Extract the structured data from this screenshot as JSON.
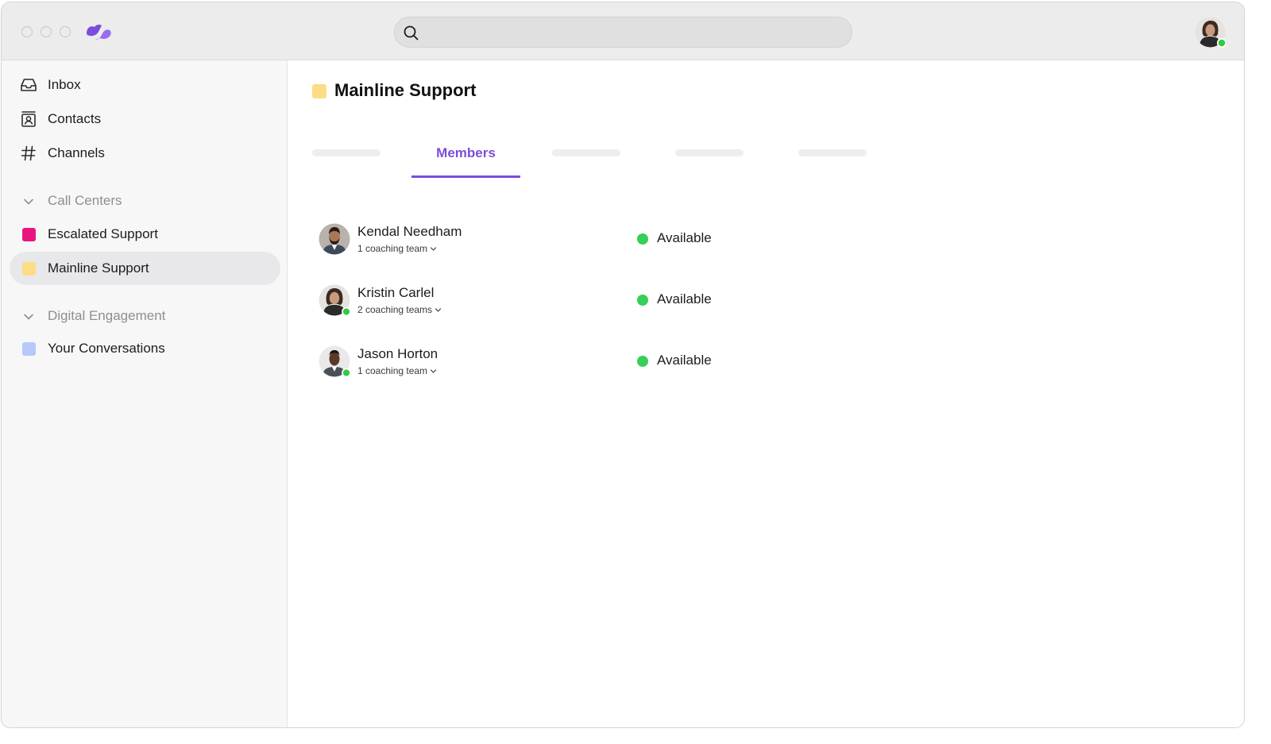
{
  "colors": {
    "accent": "#7c4ddb",
    "online": "#2ecc40",
    "available": "#34d058",
    "escalated_support": "#e8157f",
    "mainline_support": "#fcdc85",
    "your_conversations": "#b6c8fa"
  },
  "search": {
    "placeholder": ""
  },
  "sidebar": {
    "nav": [
      {
        "label": "Inbox",
        "icon": "inbox-icon"
      },
      {
        "label": "Contacts",
        "icon": "contacts-icon"
      },
      {
        "label": "Channels",
        "icon": "hash-icon"
      }
    ],
    "sections": [
      {
        "title": "Call Centers",
        "items": [
          {
            "label": "Escalated Support",
            "color": "#e8157f"
          },
          {
            "label": "Mainline Support",
            "color": "#fcdc85",
            "selected": true
          }
        ]
      },
      {
        "title": "Digital Engagement",
        "items": [
          {
            "label": "Your Conversations",
            "color": "#b6c8fa"
          }
        ]
      }
    ]
  },
  "main": {
    "title": "Mainline Support",
    "tabs": [
      {
        "label": ""
      },
      {
        "label": "Members",
        "active": true
      },
      {
        "label": ""
      },
      {
        "label": ""
      },
      {
        "label": ""
      }
    ],
    "members": [
      {
        "name": "Kendal Needham",
        "teams": "1 coaching team",
        "status": "Available",
        "online": false
      },
      {
        "name": "Kristin Carlel",
        "teams": "2 coaching teams",
        "status": "Available",
        "online": true
      },
      {
        "name": "Jason Horton",
        "teams": "1 coaching team",
        "status": "Available",
        "online": true
      }
    ]
  }
}
